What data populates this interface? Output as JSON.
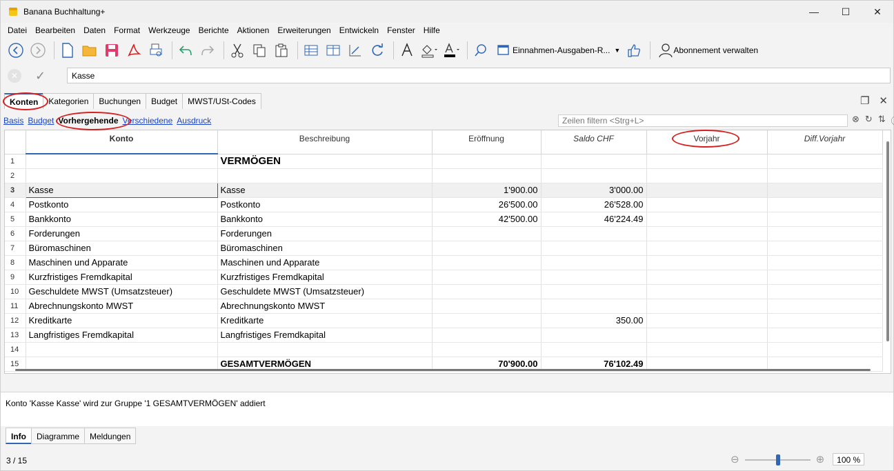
{
  "window": {
    "title": "Banana Buchhaltung+"
  },
  "menu": [
    "Datei",
    "Bearbeiten",
    "Daten",
    "Format",
    "Werkzeuge",
    "Berichte",
    "Aktionen",
    "Erweiterungen",
    "Entwickeln",
    "Fenster",
    "Hilfe"
  ],
  "toolbar": {
    "layout_combo": "Einnahmen-Ausgaben-R...",
    "subscription": "Abonnement verwalten"
  },
  "edit": {
    "value": "Kasse"
  },
  "tabs": [
    "Konten",
    "Kategorien",
    "Buchungen",
    "Budget",
    "MWST/USt-Codes"
  ],
  "subviews": [
    "Basis",
    "Budget",
    "Vorhergehende",
    "Verschiedene",
    "Ausdruck"
  ],
  "filter": {
    "placeholder": "Zeilen filtern <Strg+L>"
  },
  "grid": {
    "headers": [
      "Konto",
      "Beschreibung",
      "Eröffnung",
      "Saldo CHF",
      "Vorjahr",
      "Diff.Vorjahr"
    ],
    "rows": [
      {
        "n": "1",
        "konto": "",
        "desc": "VERMÖGEN",
        "open": "",
        "saldo": "",
        "vj": "",
        "diff": ""
      },
      {
        "n": "2",
        "konto": "",
        "desc": "",
        "open": "",
        "saldo": "",
        "vj": "",
        "diff": ""
      },
      {
        "n": "3",
        "konto": "Kasse",
        "desc": "Kasse",
        "open": "1'900.00",
        "saldo": "3'000.00",
        "vj": "",
        "diff": ""
      },
      {
        "n": "4",
        "konto": "Postkonto",
        "desc": "Postkonto",
        "open": "26'500.00",
        "saldo": "26'528.00",
        "vj": "",
        "diff": ""
      },
      {
        "n": "5",
        "konto": "Bankkonto",
        "desc": "Bankkonto",
        "open": "42'500.00",
        "saldo": "46'224.49",
        "vj": "",
        "diff": ""
      },
      {
        "n": "6",
        "konto": "Forderungen",
        "desc": "Forderungen",
        "open": "",
        "saldo": "",
        "vj": "",
        "diff": ""
      },
      {
        "n": "7",
        "konto": "Büromaschinen",
        "desc": "Büromaschinen",
        "open": "",
        "saldo": "",
        "vj": "",
        "diff": ""
      },
      {
        "n": "8",
        "konto": "Maschinen und Apparate",
        "desc": "Maschinen und Apparate",
        "open": "",
        "saldo": "",
        "vj": "",
        "diff": ""
      },
      {
        "n": "9",
        "konto": "Kurzfristiges Fremdkapital",
        "desc": "Kurzfristiges Fremdkapital",
        "open": "",
        "saldo": "",
        "vj": "",
        "diff": ""
      },
      {
        "n": "10",
        "konto": "Geschuldete MWST (Umsatzsteuer)",
        "desc": "Geschuldete MWST (Umsatzsteuer)",
        "open": "",
        "saldo": "",
        "vj": "",
        "diff": ""
      },
      {
        "n": "11",
        "konto": "Abrechnungskonto MWST",
        "desc": "Abrechnungskonto MWST",
        "open": "",
        "saldo": "",
        "vj": "",
        "diff": ""
      },
      {
        "n": "12",
        "konto": "Kreditkarte",
        "desc": "Kreditkarte",
        "open": "",
        "saldo": "350.00",
        "vj": "",
        "diff": ""
      },
      {
        "n": "13",
        "konto": "Langfristiges Fremdkapital",
        "desc": "Langfristiges Fremdkapital",
        "open": "",
        "saldo": "",
        "vj": "",
        "diff": ""
      },
      {
        "n": "14",
        "konto": "",
        "desc": "",
        "open": "",
        "saldo": "",
        "vj": "",
        "diff": ""
      },
      {
        "n": "15",
        "konto": "",
        "desc": "GESAMTVERMÖGEN",
        "open": "70'900.00",
        "saldo": "76'102.49",
        "vj": "",
        "diff": ""
      }
    ]
  },
  "info": {
    "message": "Konto 'Kasse Kasse' wird zur Gruppe '1 GESAMTVERMÖGEN' addiert"
  },
  "bottom_tabs": [
    "Info",
    "Diagramme",
    "Meldungen"
  ],
  "status": {
    "position": "3 / 15",
    "zoom": "100 %",
    "zoom_level": 0.5
  }
}
